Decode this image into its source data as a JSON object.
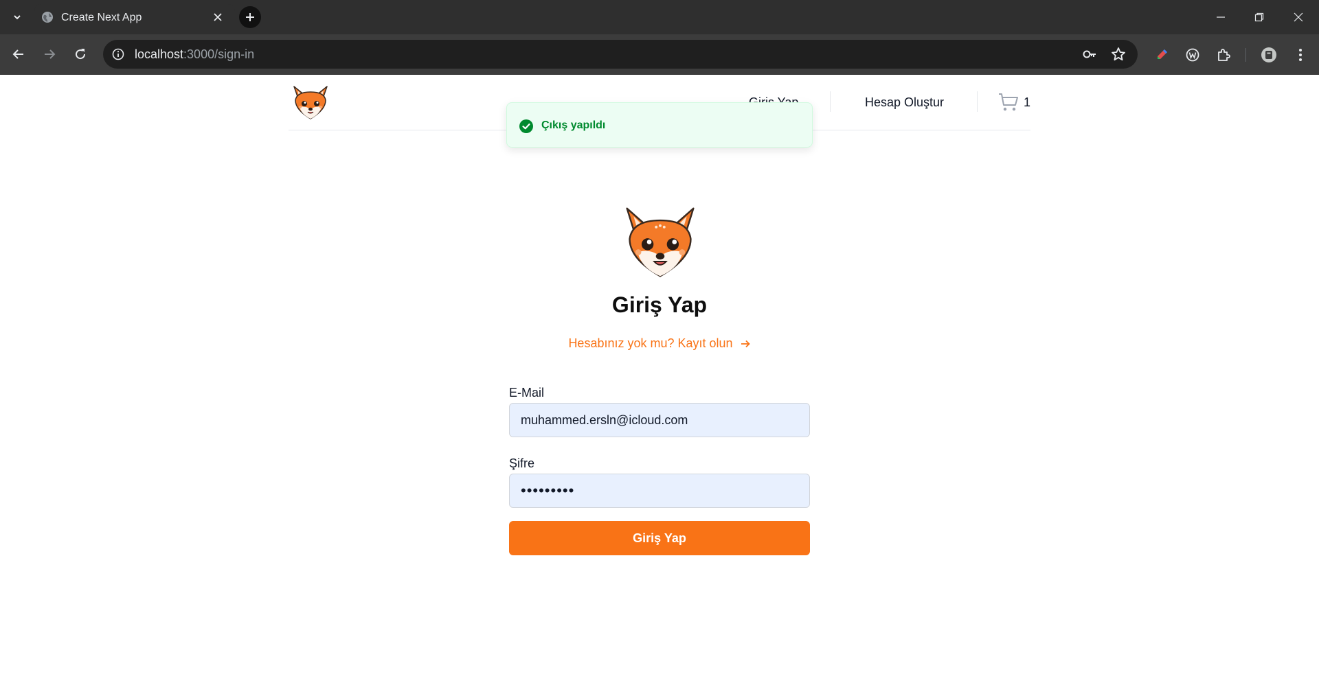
{
  "browser": {
    "tab_title": "Create Next App",
    "url_host": "localhost",
    "url_path": ":3000/sign-in",
    "icons": [
      "chevron-down-icon",
      "globe-icon",
      "close-icon",
      "plus-icon",
      "minimize-icon",
      "restore-icon",
      "close-window-icon",
      "back-arrow-icon",
      "forward-arrow-icon",
      "reload-icon",
      "site-info-icon",
      "key-icon",
      "star-icon",
      "extension-icons",
      "puzzle-icon",
      "profile-icon",
      "more-vert-icon"
    ]
  },
  "header": {
    "nav_login": "Giriş Yap",
    "nav_register": "Hesap Oluştur",
    "cart_count": "1"
  },
  "toast": {
    "message": "Çıkış yapıldı",
    "color": "#008a2e"
  },
  "signin": {
    "title": "Giriş Yap",
    "signup_prompt": "Hesabınız yok mu? Kayıt olun",
    "email_label": "E-Mail",
    "email_value": "muhammed.ersln@icloud.com",
    "password_label": "Şifre",
    "password_value": "•••••••••",
    "submit_label": "Giriş Yap"
  },
  "colors": {
    "accent": "#f97316",
    "input_bg": "#e8f0fe",
    "toast_bg": "#ecfdf3"
  }
}
